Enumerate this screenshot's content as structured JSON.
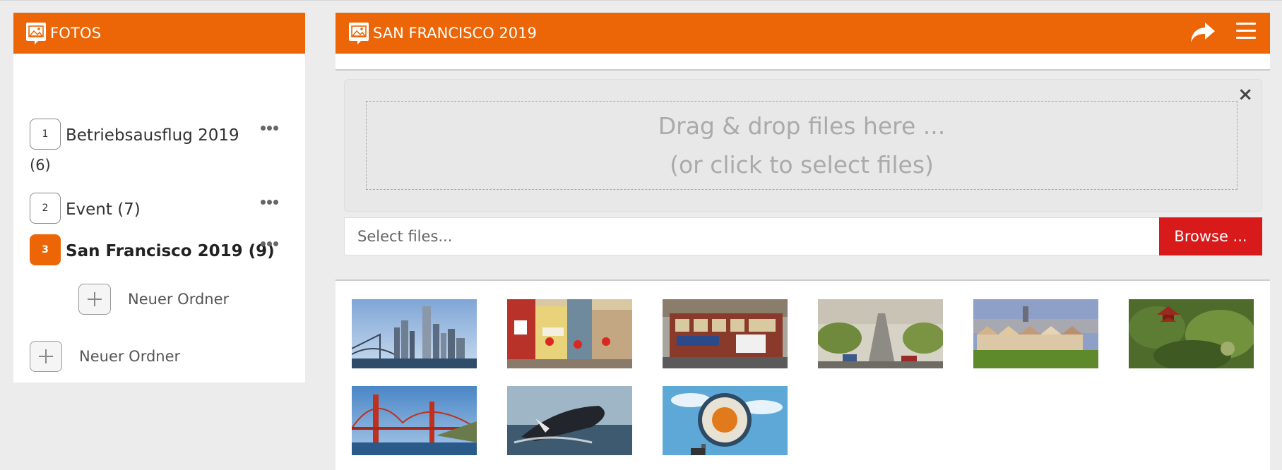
{
  "sidebar": {
    "title": "FOTOS",
    "folders": [
      {
        "badge": "1",
        "label": "Betriebsausflug 2019",
        "count": "(6)"
      },
      {
        "badge": "2",
        "label": "Event (7)"
      },
      {
        "badge": "3",
        "label": "San Francisco 2019 (9)"
      }
    ],
    "subfolder_add_label": "Neuer Ordner",
    "add_label": "Neuer Ordner"
  },
  "main": {
    "title": "SAN FRANCISCO 2019",
    "upload": {
      "drop_line1": "Drag & drop files here ...",
      "drop_line2": "(or click to select files)",
      "close_symbol": "×",
      "input_placeholder": "Select files...",
      "browse_label": "Browse ..."
    },
    "photos": [
      {
        "subject": "skyline-bay-bridge"
      },
      {
        "subject": "chinatown"
      },
      {
        "subject": "cable-car"
      },
      {
        "subject": "steep-street"
      },
      {
        "subject": "painted-ladies"
      },
      {
        "subject": "japanese-tea-garden"
      },
      {
        "subject": "golden-gate-bridge"
      },
      {
        "subject": "whale"
      },
      {
        "subject": "fishermans-wharf-sign"
      }
    ]
  },
  "colors": {
    "accent": "#ec6608",
    "browse": "#d81a1a",
    "background": "#ececec"
  }
}
